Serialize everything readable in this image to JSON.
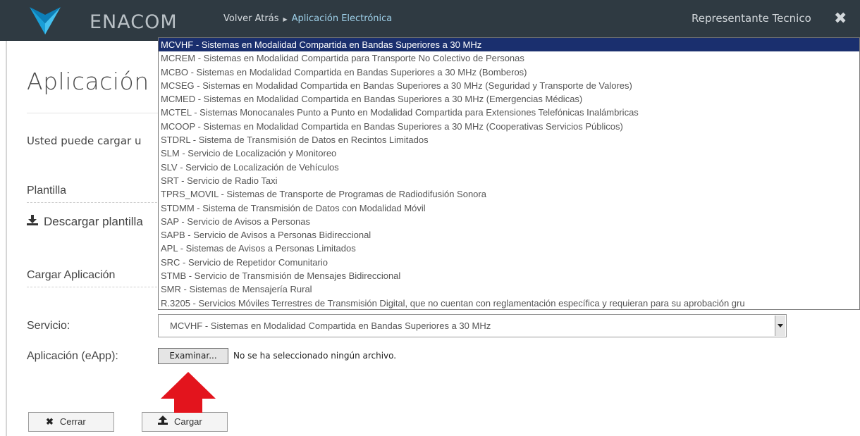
{
  "header": {
    "brand": "ENACOM",
    "breadcrumb": {
      "back": "Volver Atrás",
      "current": "Aplicación Electrónica"
    },
    "user": "Representante Tecnico"
  },
  "main": {
    "title": "Aplicación E",
    "intro": "Usted puede cargar u",
    "plantilla_label": "Plantilla",
    "download_label": "Descargar plantilla",
    "cargar_label": "Cargar Aplicación",
    "servicio_label": "Servicio:",
    "servicio_value": "MCVHF - Sistemas en Modalidad Compartida en Bandas Superiores a 30 MHz",
    "aplicacion_label": "Aplicación (eApp):",
    "browse_label": "Examinar...",
    "no_file": "No se ha seleccionado ningún archivo.",
    "close_button": "Cerrar",
    "upload_button": "Cargar"
  },
  "dropdown": {
    "selected_index": 0,
    "options": [
      "MCVHF - Sistemas en Modalidad Compartida en Bandas Superiores a 30 MHz",
      "MCREM - Sistemas en Modalidad Compartida para Transporte No Colectivo de Personas",
      "MCBO - Sistemas en Modalidad Compartida en Bandas Superiores a 30 MHz (Bomberos)",
      "MCSEG - Sistemas en Modalidad Compartida en Bandas Superiores a 30 MHz (Seguridad y Transporte de Valores)",
      "MCMED - Sistemas en Modalidad Compartida en Bandas Superiores a 30 MHz (Emergencias Médicas)",
      "MCTEL - Sistemas Monocanales Punto a Punto en Modalidad Compartida para Extensiones Telefónicas Inalámbricas",
      "MCOOP - Sistemas en Modalidad Compartida en Bandas Superiores a 30 MHz (Cooperativas Servicios Públicos)",
      "STDRL - Sistema de Transmisión de Datos en Recintos Limitados",
      "SLM - Servicio de Localización y Monitoreo",
      "SLV - Servicio de Localización de Vehículos",
      "SRT - Servicio de Radio Taxi",
      "TPRS_MOVIL - Sistemas de Transporte de Programas de Radiodifusión Sonora",
      "STDMM - Sistema de Transmisión de Datos con Modalidad Móvil",
      "SAP - Servicio de Avisos a Personas",
      "SAPB - Servicio de Avisos a Personas Bidireccional",
      "APL - Sistemas de Avisos a Personas Limitados",
      "SRC - Servicio de Repetidor Comunitario",
      "STMB - Servicio de Transmisión de Mensajes Bidireccional",
      "SMR - Sistemas de Mensajería Rural",
      "R.3205 - Servicios Móviles Terrestres de Transmisión Digital, que no cuentan con reglamentación específica y requieran para su aprobación gru"
    ]
  },
  "icons": {
    "close": "close-icon",
    "download": "download-icon",
    "upload": "upload-icon",
    "arrow": "red-up-arrow"
  },
  "colors": {
    "topbar": "#2f3a42",
    "logo": "#1aa0d8",
    "selected_option": "#1a2f6e",
    "arrow": "#e3141d"
  }
}
